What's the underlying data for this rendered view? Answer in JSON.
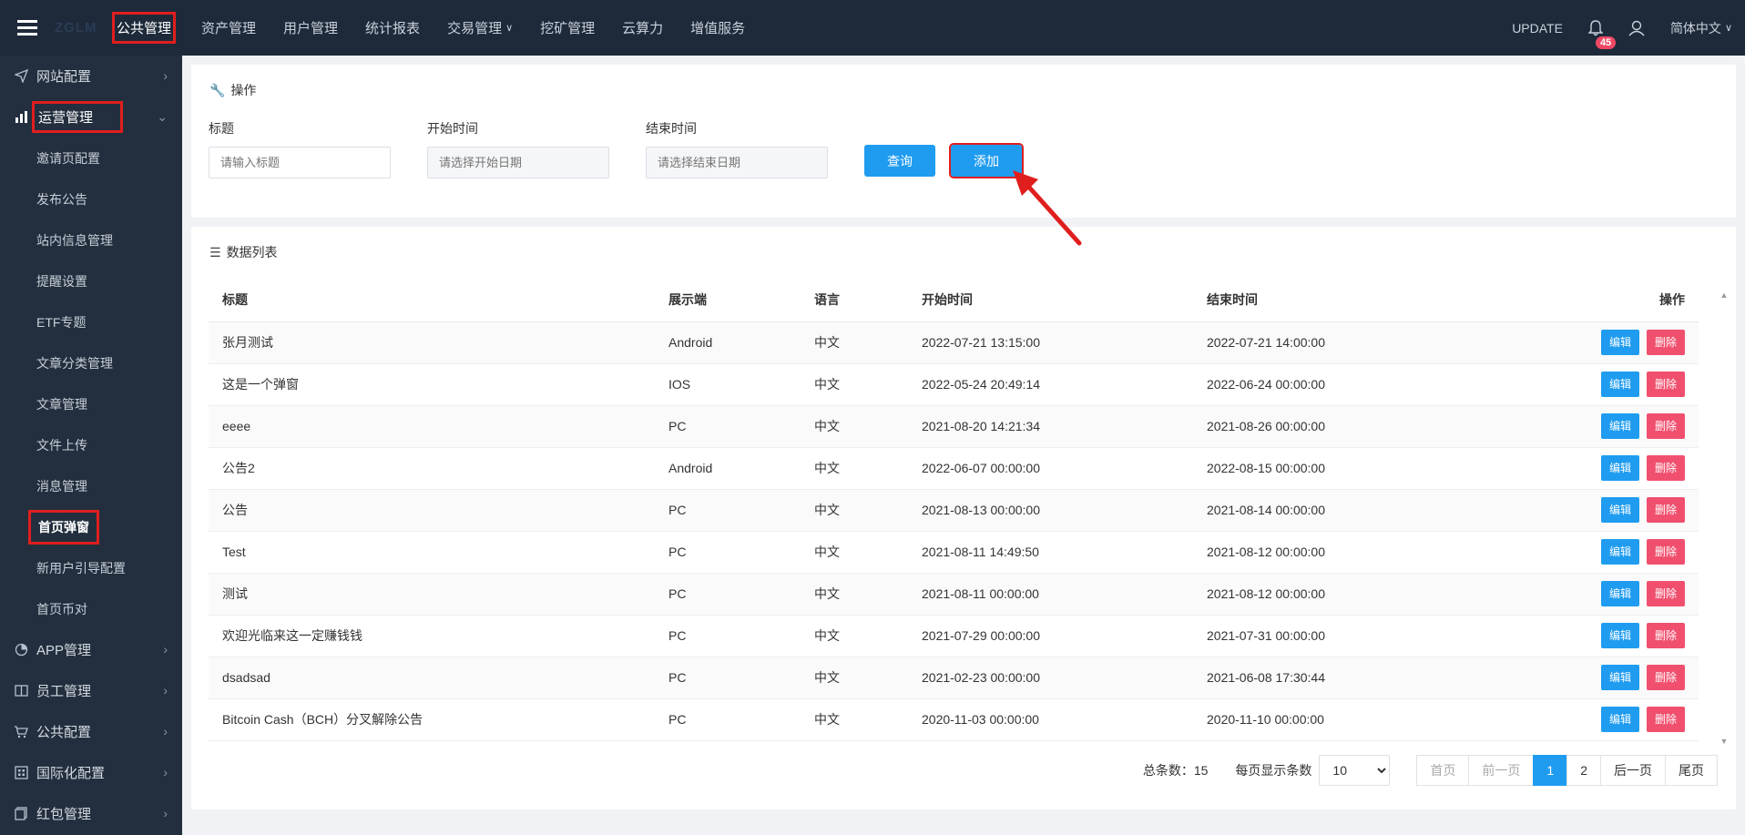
{
  "topbar": {
    "logo": "ZGLM",
    "nav": [
      {
        "label": "公共管理",
        "active": true
      },
      {
        "label": "资产管理"
      },
      {
        "label": "用户管理"
      },
      {
        "label": "统计报表"
      },
      {
        "label": "交易管理",
        "caret": true
      },
      {
        "label": "挖矿管理"
      },
      {
        "label": "云算力"
      },
      {
        "label": "增值服务"
      }
    ],
    "update": "UPDATE",
    "notif_count": "45",
    "language": "简体中文"
  },
  "sidebar": {
    "groups_top": [
      {
        "label": "网站配置",
        "icon": "send-icon"
      },
      {
        "label": "运营管理",
        "icon": "chart-icon",
        "open": true
      }
    ],
    "subitems": [
      "邀请页配置",
      "发布公告",
      "站内信息管理",
      "提醒设置",
      "ETF专题",
      "文章分类管理",
      "文章管理",
      "文件上传",
      "消息管理",
      "首页弹窗",
      "新用户引导配置",
      "首页币对"
    ],
    "active_sub": "首页弹窗",
    "groups_bottom": [
      {
        "label": "APP管理",
        "icon": "clock-icon"
      },
      {
        "label": "员工管理",
        "icon": "book-icon"
      },
      {
        "label": "公共配置",
        "icon": "cart-icon"
      },
      {
        "label": "国际化配置",
        "icon": "grid-icon"
      },
      {
        "label": "红包管理",
        "icon": "copy-icon"
      }
    ]
  },
  "ops": {
    "title": "操作",
    "fields": {
      "title_label": "标题",
      "title_placeholder": "请输入标题",
      "start_label": "开始时间",
      "start_placeholder": "请选择开始日期",
      "end_label": "结束时间",
      "end_placeholder": "请选择结束日期"
    },
    "query_label": "查询",
    "add_label": "添加"
  },
  "list": {
    "title": "数据列表",
    "columns": [
      "标题",
      "展示端",
      "语言",
      "开始时间",
      "结束时间",
      "操作"
    ],
    "edit_label": "编辑",
    "delete_label": "删除",
    "rows": [
      [
        "张月测试",
        "Android",
        "中文",
        "2022-07-21 13:15:00",
        "2022-07-21 14:00:00"
      ],
      [
        "这是一个弹窗",
        "IOS",
        "中文",
        "2022-05-24 20:49:14",
        "2022-06-24 00:00:00"
      ],
      [
        "eeee",
        "PC",
        "中文",
        "2021-08-20 14:21:34",
        "2021-08-26 00:00:00"
      ],
      [
        "公告2",
        "Android",
        "中文",
        "2022-06-07 00:00:00",
        "2022-08-15 00:00:00"
      ],
      [
        "公告",
        "PC",
        "中文",
        "2021-08-13 00:00:00",
        "2021-08-14 00:00:00"
      ],
      [
        "Test",
        "PC",
        "中文",
        "2021-08-11 14:49:50",
        "2021-08-12 00:00:00"
      ],
      [
        "测试",
        "PC",
        "中文",
        "2021-08-11 00:00:00",
        "2021-08-12 00:00:00"
      ],
      [
        "欢迎光临来这一定赚钱钱",
        "PC",
        "中文",
        "2021-07-29 00:00:00",
        "2021-07-31 00:00:00"
      ],
      [
        "dsadsad",
        "PC",
        "中文",
        "2021-02-23 00:00:00",
        "2021-06-08 17:30:44"
      ],
      [
        "Bitcoin Cash（BCH）分叉解除公告",
        "PC",
        "中文",
        "2020-11-03 00:00:00",
        "2020-11-10 00:00:00"
      ]
    ]
  },
  "pager": {
    "total_label": "总条数：",
    "total": "15",
    "per_label": "每页显示条数",
    "per_value": "10",
    "first": "首页",
    "prev": "前一页",
    "pages": [
      "1",
      "2"
    ],
    "current": "1",
    "next": "后一页",
    "last": "尾页"
  },
  "colors": {
    "accent": "#1f9cf0",
    "danger": "#f0506e",
    "highlight": "#e01e1e",
    "topbar": "#1e2a3a",
    "sidebar": "#232f3e"
  }
}
